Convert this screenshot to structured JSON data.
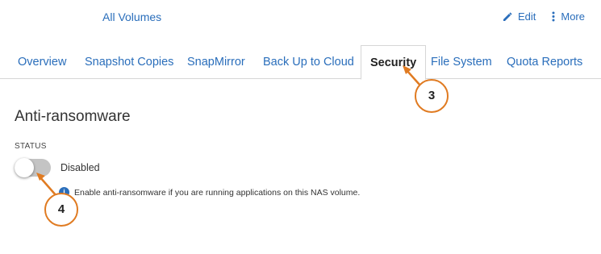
{
  "breadcrumb": {
    "label": "All Volumes"
  },
  "actions": {
    "edit_label": "Edit",
    "more_label": "More"
  },
  "tabs": [
    {
      "label": "Overview"
    },
    {
      "label": "Snapshot Copies"
    },
    {
      "label": "SnapMirror"
    },
    {
      "label": "Back Up to Cloud"
    },
    {
      "label": "Security",
      "active": true
    },
    {
      "label": "File System"
    },
    {
      "label": "Quota Reports"
    }
  ],
  "section": {
    "title": "Anti-ransomware",
    "status_label": "STATUS",
    "toggle_state": "Disabled",
    "info_icon_glyph": "i",
    "info_text": "Enable anti-ransomware if you are running applications on this NAS volume."
  },
  "callouts": {
    "tab_marker": "3",
    "toggle_marker": "4"
  },
  "colors": {
    "link": "#2a6ebb",
    "callout_border": "#e07b22",
    "toggle_off": "#c4c4c4",
    "tab_border": "#d6d6d6"
  },
  "icons": {
    "edit": "pencil-icon",
    "more": "kebab-menu-icon",
    "info": "info-icon"
  }
}
